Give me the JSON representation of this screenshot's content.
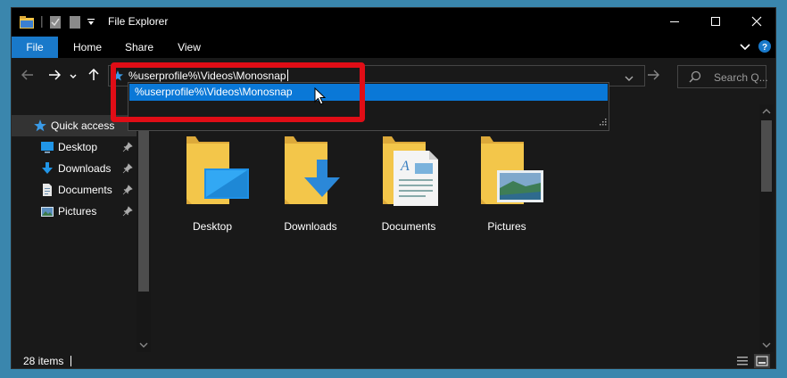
{
  "window": {
    "title": "File Explorer",
    "controls": [
      "minimize",
      "maximize",
      "close"
    ]
  },
  "ribbon": {
    "tabs": [
      "File",
      "Home",
      "Share",
      "View"
    ]
  },
  "address_bar": {
    "value": "%userprofile%\\Videos\\Monosnap",
    "suggestion": "%userprofile%\\Videos\\Monosnap"
  },
  "search": {
    "placeholder": "Search Q..."
  },
  "nav_pane": {
    "items": [
      {
        "label": "Quick access",
        "icon": "star-icon",
        "pinned": false
      },
      {
        "label": "Desktop",
        "icon": "desktop-icon",
        "pinned": true
      },
      {
        "label": "Downloads",
        "icon": "download-icon",
        "pinned": true
      },
      {
        "label": "Documents",
        "icon": "documents-icon",
        "pinned": true
      },
      {
        "label": "Pictures",
        "icon": "pictures-icon",
        "pinned": true
      }
    ]
  },
  "content": {
    "folders": [
      {
        "label": "Desktop",
        "overlay": "desktop"
      },
      {
        "label": "Downloads",
        "overlay": "download-arrow"
      },
      {
        "label": "Documents",
        "overlay": "document"
      },
      {
        "label": "Pictures",
        "overlay": "landscape"
      }
    ]
  },
  "status_bar": {
    "items_count": "28 items"
  },
  "colors": {
    "accent": "#0a78d7",
    "file_tab": "#1979ca",
    "highlight_border": "#e00d16",
    "window_bg": "#191919",
    "titlebar_bg": "#000000",
    "folder_yellow": "#f3c64a"
  }
}
